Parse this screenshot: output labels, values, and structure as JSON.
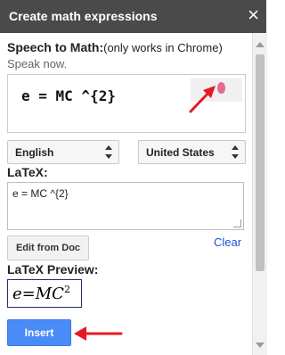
{
  "window": {
    "title": "Create math expressions",
    "close_glyph": "×"
  },
  "speech": {
    "label": "Speech to Math:",
    "note": "(only works in Chrome)",
    "prompt": "Speak now.",
    "recognized_text": "e = MC ^{2}"
  },
  "selects": {
    "language": "English",
    "region": "United States"
  },
  "latex": {
    "label": "LaTeX:",
    "value": "e = MC ^{2}"
  },
  "buttons": {
    "edit_from_doc": "Edit from Doc",
    "clear": "Clear",
    "insert": "Insert"
  },
  "preview": {
    "label": "LaTeX Preview:",
    "base": "e=MC",
    "exponent": "2"
  },
  "colors": {
    "titlebar": "#4a4a4a",
    "primary": "#4a8cf7",
    "link": "#1a55d6",
    "annotation_arrow": "#e31b23",
    "mic": "#e36c8f"
  },
  "icons": {
    "close": "close-icon",
    "mic": "microphone-icon",
    "select_arrows": "updown-chevrons-icon",
    "annotation_arrow": "red-arrow-icon"
  }
}
